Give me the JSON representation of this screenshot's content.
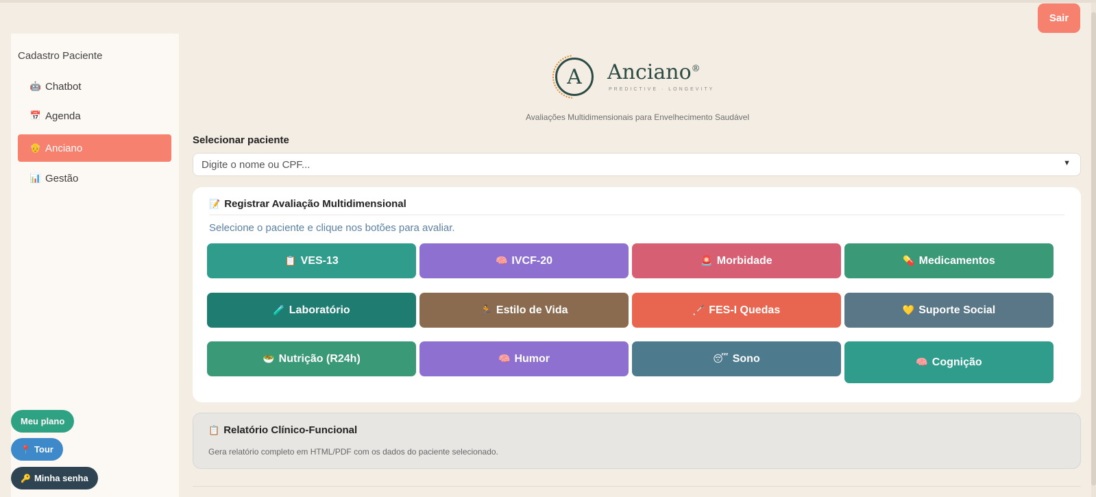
{
  "header": {
    "logout_label": "Sair"
  },
  "brand": {
    "name": "Anciano",
    "registered": "®",
    "logo_letter": "A",
    "tagline": "PREDICTIVE · LONGEVITY",
    "subtitle": "Avaliações Multidimensionais para Envelhecimento Saudável"
  },
  "sidebar": {
    "title": "Cadastro Paciente",
    "items": [
      {
        "icon": "robot-icon",
        "glyph": "🤖",
        "label": "Chatbot",
        "active": false
      },
      {
        "icon": "calendar-icon",
        "glyph": "📅",
        "label": "Agenda",
        "active": false
      },
      {
        "icon": "elder-icon",
        "glyph": "👴",
        "label": "Anciano",
        "active": true
      },
      {
        "icon": "dashboard-icon",
        "glyph": "📊",
        "label": "Gestão",
        "active": false
      }
    ],
    "footer_buttons": [
      {
        "label": "Meu plano",
        "color": "#2fa283",
        "glyph": ""
      },
      {
        "label": "Tour",
        "color": "#3d89c9",
        "glyph": "📍"
      },
      {
        "label": "Minha senha",
        "color": "#2f4452",
        "glyph": "🔑"
      }
    ]
  },
  "patient_select": {
    "label": "Selecionar paciente",
    "placeholder": "Digite o nome ou CPF..."
  },
  "assessment": {
    "title": "Registrar Avaliação Multidimensional",
    "title_glyph": "📝",
    "hint": "Selecione o paciente e clique nos botões para avaliar.",
    "buttons": [
      {
        "label": "VES-13",
        "glyph": "📋",
        "color": "#2f9c8c"
      },
      {
        "label": "IVCF-20",
        "glyph": "🧠",
        "color": "#8e70d1"
      },
      {
        "label": "Morbidade",
        "glyph": "🚨",
        "color": "#d65f73"
      },
      {
        "label": "Medicamentos",
        "glyph": "💊",
        "color": "#3a9a78"
      },
      {
        "label": "Laboratório",
        "glyph": "🧪",
        "color": "#1f7c70"
      },
      {
        "label": "Estilo de Vida",
        "glyph": "🏃",
        "color": "#8a6b50"
      },
      {
        "label": "FES-I Quedas",
        "glyph": "🦯",
        "color": "#e8664f"
      },
      {
        "label": "Suporte Social",
        "glyph": "💛",
        "color": "#5a7788"
      },
      {
        "label": "Nutrição (R24h)",
        "glyph": "🥗",
        "color": "#3a9a78"
      },
      {
        "label": "Humor",
        "glyph": "🧠",
        "color": "#8e70d1"
      },
      {
        "label": "Sono",
        "glyph": "😴",
        "color": "#4e7a8e"
      },
      {
        "label": "Cognição",
        "glyph": "🧠",
        "color": "#2f9c8c"
      }
    ]
  },
  "report": {
    "title": "Relatório Clínico-Funcional",
    "title_glyph": "📋",
    "description": "Gera relatório completo em HTML/PDF com os dados do paciente selecionado."
  },
  "colors": {
    "background": "#f4ede3",
    "accent": "#f7816f",
    "brand": "#2d4b45"
  }
}
